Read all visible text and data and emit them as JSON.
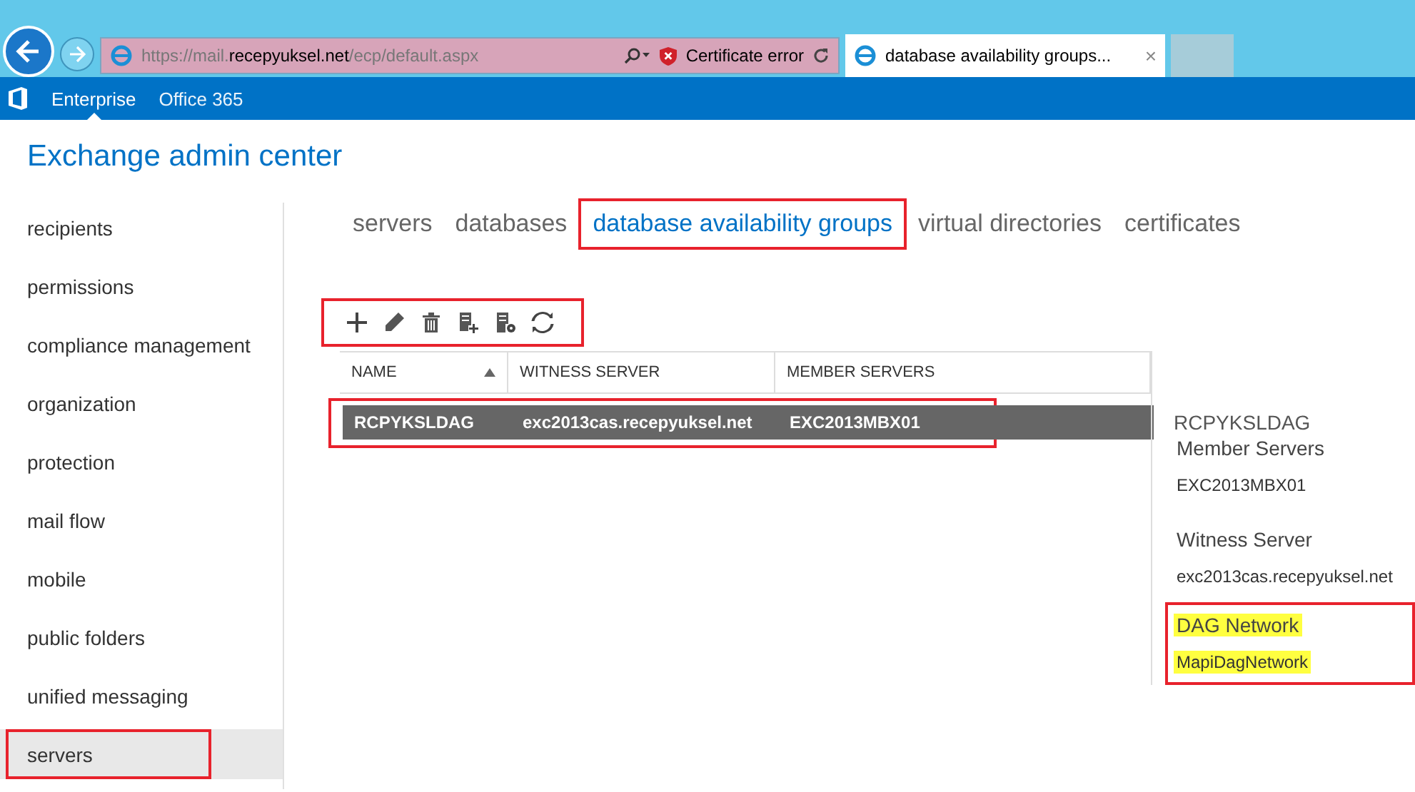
{
  "browser": {
    "address": {
      "prefix": "https://mail.",
      "domain": "recepyuksel.net",
      "path": "/ecp/default.aspx"
    },
    "certificate_error": "Certificate error",
    "tabs": [
      {
        "title": "database availability groups...",
        "close": "×",
        "selected": true
      }
    ]
  },
  "suite_bar": {
    "items": [
      {
        "label": "Enterprise",
        "selected": true
      },
      {
        "label": "Office 365",
        "selected": false
      }
    ]
  },
  "title": "Exchange admin center",
  "sidebar": {
    "items": [
      {
        "label": "recipients",
        "selected": false,
        "annotated": false
      },
      {
        "label": "permissions",
        "selected": false,
        "annotated": false
      },
      {
        "label": "compliance management",
        "selected": false,
        "annotated": false
      },
      {
        "label": "organization",
        "selected": false,
        "annotated": false
      },
      {
        "label": "protection",
        "selected": false,
        "annotated": false
      },
      {
        "label": "mail flow",
        "selected": false,
        "annotated": false
      },
      {
        "label": "mobile",
        "selected": false,
        "annotated": false
      },
      {
        "label": "public folders",
        "selected": false,
        "annotated": false
      },
      {
        "label": "unified messaging",
        "selected": false,
        "annotated": false
      },
      {
        "label": "servers",
        "selected": true,
        "annotated": true
      }
    ]
  },
  "tabs": [
    {
      "label": "servers",
      "selected": false,
      "annotated": false
    },
    {
      "label": "databases",
      "selected": false,
      "annotated": false
    },
    {
      "label": "database availability groups",
      "selected": true,
      "annotated": true
    },
    {
      "label": "virtual directories",
      "selected": false,
      "annotated": false
    },
    {
      "label": "certificates",
      "selected": false,
      "annotated": false
    }
  ],
  "toolbar": {
    "annotated": true,
    "buttons": [
      {
        "kind": "add"
      },
      {
        "kind": "edit"
      },
      {
        "kind": "delete"
      },
      {
        "kind": "add-server"
      },
      {
        "kind": "configure"
      },
      {
        "kind": "refresh"
      }
    ]
  },
  "table": {
    "columns": [
      {
        "label": "NAME",
        "sorted": true
      },
      {
        "label": "WITNESS SERVER",
        "sorted": false
      },
      {
        "label": "MEMBER SERVERS",
        "sorted": false
      }
    ],
    "rows": [
      {
        "cells": [
          "RCPYKSLDAG",
          "exc2013cas.recepyuksel.net",
          "EXC2013MBX01"
        ],
        "selected": true,
        "annotated": true
      }
    ]
  },
  "details": {
    "title": "RCPYKSLDAG",
    "sections": [
      {
        "heading": "Member Servers",
        "value": "EXC2013MBX01",
        "highlighted": false,
        "annotated": false
      },
      {
        "heading": "Witness Server",
        "value": "exc2013cas.recepyuksel.net",
        "highlighted": false,
        "annotated": false
      },
      {
        "heading": "DAG Network",
        "value": "MapiDagNetwork",
        "highlighted": true,
        "annotated": true
      }
    ]
  }
}
